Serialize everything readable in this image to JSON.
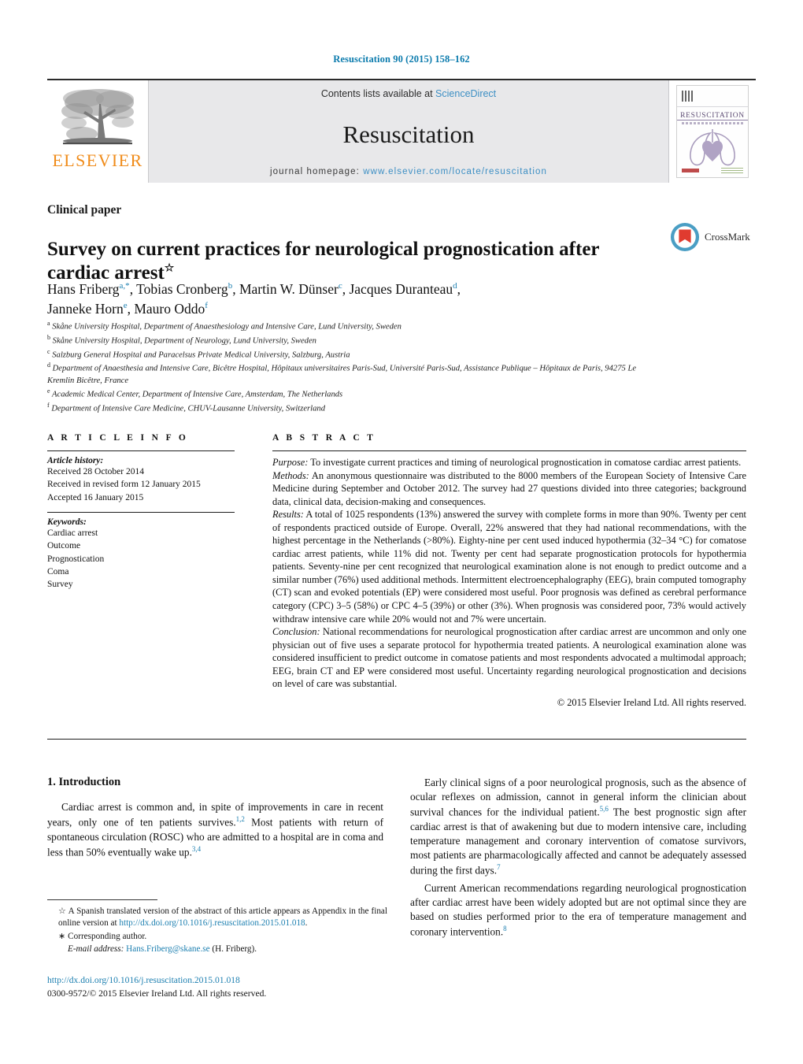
{
  "running_head": "Resuscitation 90 (2015) 158–162",
  "masthead": {
    "publisher_name": "ELSEVIER",
    "contents_prefix": "Contents lists available at ",
    "contents_link": "ScienceDirect",
    "journal_name": "Resuscitation",
    "homepage_prefix": "journal homepage: ",
    "homepage_url": "www.elsevier.com/locate/resuscitation",
    "cover_title": "RESUSCITATION",
    "accent_link_color": "#3d8fc4",
    "publisher_color": "#f08c1b"
  },
  "article": {
    "section_label": "Clinical paper",
    "title": "Survey on current practices for neurological prognostication after cardiac arrest",
    "title_footnote_mark": "☆",
    "crossmark_label": "CrossMark",
    "authors": [
      {
        "name": "Hans Friberg",
        "marks": "a,*"
      },
      {
        "name": "Tobias Cronberg",
        "marks": "b"
      },
      {
        "name": "Martin W. Dünser",
        "marks": "c"
      },
      {
        "name": "Jacques Duranteau",
        "marks": "d"
      },
      {
        "name": "Janneke Horn",
        "marks": "e"
      },
      {
        "name": "Mauro Oddo",
        "marks": "f"
      }
    ],
    "affiliations": [
      {
        "mark": "a",
        "text": "Skåne University Hospital, Department of Anaesthesiology and Intensive Care, Lund University, Sweden"
      },
      {
        "mark": "b",
        "text": "Skåne University Hospital, Department of Neurology, Lund University, Sweden"
      },
      {
        "mark": "c",
        "text": "Salzburg General Hospital and Paracelsus Private Medical University, Salzburg, Austria"
      },
      {
        "mark": "d",
        "text": "Department of Anaesthesia and Intensive Care, Bicêtre Hospital, Hôpitaux universitaires Paris-Sud, Université Paris-Sud, Assistance Publique – Hôpitaux de Paris, 94275 Le Kremlin Bicêtre, France"
      },
      {
        "mark": "e",
        "text": "Academic Medical Center, Department of Intensive Care, Amsterdam, The Netherlands"
      },
      {
        "mark": "f",
        "text": "Department of Intensive Care Medicine, CHUV-Lausanne University, Switzerland"
      }
    ]
  },
  "article_info": {
    "heading": "A R T I C L E   I N F O",
    "history_label": "Article history:",
    "history": [
      "Received 28 October 2014",
      "Received in revised form 12 January 2015",
      "Accepted 16 January 2015"
    ],
    "keywords_label": "Keywords:",
    "keywords": [
      "Cardiac arrest",
      "Outcome",
      "Prognostication",
      "Coma",
      "Survey"
    ]
  },
  "abstract": {
    "heading": "A B S T R A C T",
    "purpose_label": "Purpose:",
    "purpose_text": " To investigate current practices and timing of neurological prognostication in comatose cardiac arrest patients.",
    "methods_label": "Methods:",
    "methods_text": " An anonymous questionnaire was distributed to the 8000 members of the European Society of Intensive Care Medicine during September and October 2012. The survey had 27 questions divided into three categories; background data, clinical data, decision-making and consequences.",
    "results_label": "Results:",
    "results_text": " A total of 1025 respondents (13%) answered the survey with complete forms in more than 90%. Twenty per cent of respondents practiced outside of Europe. Overall, 22% answered that they had national recommendations, with the highest percentage in the Netherlands (>80%). Eighty-nine per cent used induced hypothermia (32–34 °C) for comatose cardiac arrest patients, while 11% did not. Twenty per cent had separate prognostication protocols for hypothermia patients. Seventy-nine per cent recognized that neurological examination alone is not enough to predict outcome and a similar number (76%) used additional methods. Intermittent electroencephalography (EEG), brain computed tomography (CT) scan and evoked potentials (EP) were considered most useful. Poor prognosis was defined as cerebral performance category (CPC) 3–5 (58%) or CPC 4–5 (39%) or other (3%). When prognosis was considered poor, 73% would actively withdraw intensive care while 20% would not and 7% were uncertain.",
    "conclusion_label": "Conclusion:",
    "conclusion_text": " National recommendations for neurological prognostication after cardiac arrest are uncommon and only one physician out of five uses a separate protocol for hypothermia treated patients. A neurological examination alone was considered insufficient to predict outcome in comatose patients and most respondents advocated a multimodal approach; EEG, brain CT and EP were considered most useful. Uncertainty regarding neurological prognostication and decisions on level of care was substantial.",
    "copyright": "© 2015 Elsevier Ireland Ltd. All rights reserved."
  },
  "introduction": {
    "heading": "1. Introduction",
    "left_paragraph_1_a": "Cardiac arrest is common and, in spite of improvements in care in recent years, only one of ten patients survives.",
    "left_paragraph_1_ref1": "1,2",
    "left_paragraph_1_b": " Most patients with return of spontaneous circulation (ROSC) who are admitted to a hospital are in coma and less than 50% eventually wake up.",
    "left_paragraph_1_ref2": "3,4",
    "right_paragraph_1_a": "Early clinical signs of a poor neurological prognosis, such as the absence of ocular reflexes on admission, cannot in general inform the clinician about survival chances for the individual patient.",
    "right_paragraph_1_ref1": "5,6",
    "right_paragraph_1_b": " The best prognostic sign after cardiac arrest is that of awakening but due to modern intensive care, including temperature management and coronary intervention of comatose survivors, most patients are pharmacologically affected and cannot be adequately assessed during the first days.",
    "right_paragraph_1_ref2": "7",
    "right_paragraph_2_a": "Current American recommendations regarding neurological prognostication after cardiac arrest have been widely adopted but are not optimal since they are based on studies performed prior to the era of temperature management and coronary intervention.",
    "right_paragraph_2_ref1": "8"
  },
  "footnotes": {
    "star_mark": "☆",
    "spanish_note_a": " A Spanish translated version of the abstract of this article appears as Appendix in the final online version at ",
    "spanish_note_link": "http://dx.doi.org/10.1016/j.resuscitation.2015.01.018",
    "spanish_note_b": ".",
    "corresponding_mark": "∗",
    "corresponding_label": " Corresponding author.",
    "email_label": "E-mail address:",
    "email_link": "Hans.Friberg@skane.se",
    "email_suffix": " (H. Friberg)."
  },
  "footer": {
    "doi_url": "http://dx.doi.org/10.1016/j.resuscitation.2015.01.018",
    "issn_line": "0300-9572/© 2015 Elsevier Ireland Ltd. All rights reserved."
  }
}
